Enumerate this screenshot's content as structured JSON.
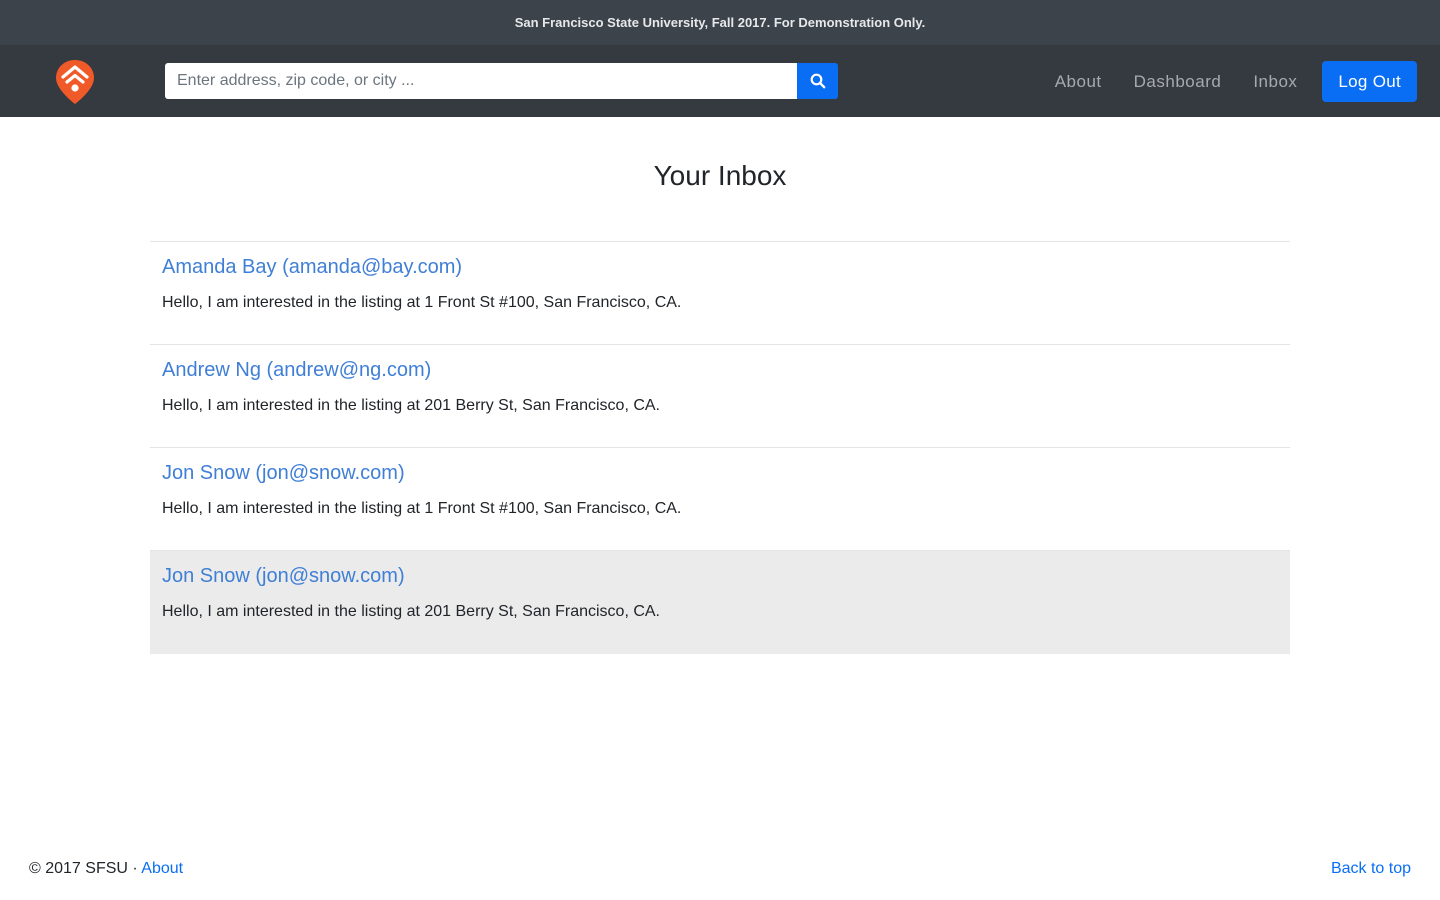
{
  "banner": {
    "text": "San Francisco State University, Fall 2017. For Demonstration Only."
  },
  "header": {
    "logo_icon": "home-pin-icon",
    "search": {
      "placeholder": "Enter address, zip code, or city ...",
      "value": "",
      "icon": "search-icon"
    },
    "nav": {
      "about": "About",
      "dashboard": "Dashboard",
      "inbox": "Inbox",
      "logout": "Log Out"
    }
  },
  "page": {
    "title": "Your Inbox"
  },
  "messages": [
    {
      "from": "Amanda Bay (amanda@bay.com)",
      "body": "Hello, I am interested in the listing at 1 Front St #100, San Francisco, CA."
    },
    {
      "from": "Andrew Ng (andrew@ng.com)",
      "body": "Hello, I am interested in the listing at 201 Berry St, San Francisco, CA."
    },
    {
      "from": "Jon Snow (jon@snow.com)",
      "body": "Hello, I am interested in the listing at 1 Front St #100, San Francisco, CA."
    },
    {
      "from": "Jon Snow (jon@snow.com)",
      "body": "Hello, I am interested in the listing at 201 Berry St, San Francisco, CA."
    }
  ],
  "footer": {
    "copyright": "© 2017 SFSU · ",
    "about": "About",
    "back_to_top": "Back to top"
  },
  "colors": {
    "accent": "#0a6ef5",
    "brand": "#f05a28",
    "navbar": "#343a40",
    "banner": "#3c434b",
    "link": "#3f7fd6",
    "hover_row": "#ebebeb"
  }
}
